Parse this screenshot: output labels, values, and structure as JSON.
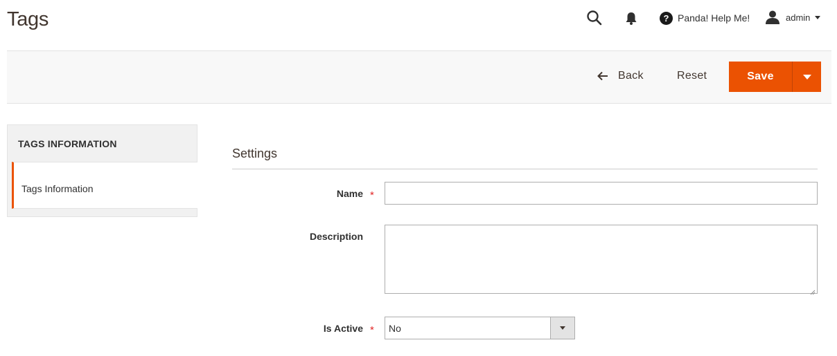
{
  "page": {
    "title": "Tags"
  },
  "header": {
    "search_icon": "search-icon",
    "notifications_icon": "bell-icon",
    "help_label": "Panda! Help Me!",
    "user_label": "admin"
  },
  "actions": {
    "back_label": "Back",
    "reset_label": "Reset",
    "save_label": "Save",
    "accent_color": "#eb5202"
  },
  "sidebar": {
    "title": "TAGS INFORMATION",
    "items": [
      {
        "label": "Tags Information",
        "active": true
      }
    ]
  },
  "form": {
    "section_title": "Settings",
    "fields": {
      "name": {
        "label": "Name",
        "required": true,
        "value": ""
      },
      "description": {
        "label": "Description",
        "required": false,
        "value": ""
      },
      "is_active": {
        "label": "Is Active",
        "required": true,
        "value": "No"
      }
    }
  }
}
